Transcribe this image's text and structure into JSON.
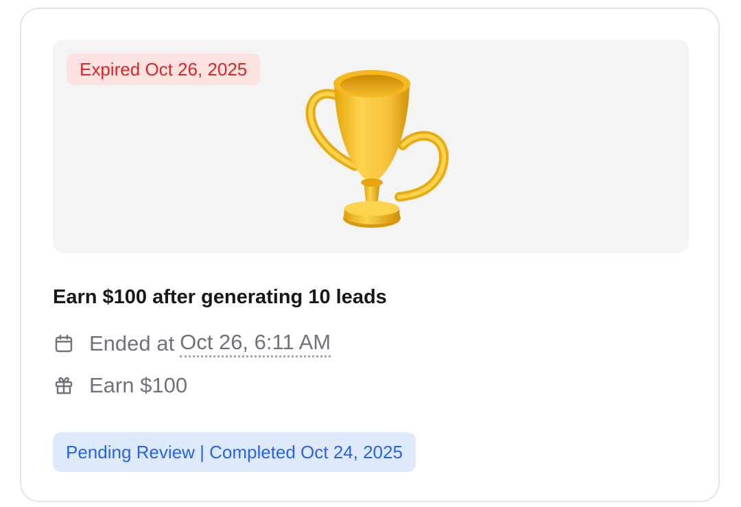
{
  "card": {
    "expired_badge": "Expired Oct 26, 2025",
    "trophy_icon": "trophy-icon",
    "title": "Earn $100 after generating 10 leads",
    "ended_prefix": "Ended at",
    "ended_date": "Oct 26, 6:11 AM",
    "reward": "Earn $100",
    "status": "Pending Review | Completed Oct 24, 2025"
  },
  "colors": {
    "expired_bg": "#fde2e2",
    "expired_text": "#dc2626",
    "status_bg": "#dfe9fc",
    "status_text": "#2563eb",
    "hero_bg": "#f4f4f5"
  }
}
